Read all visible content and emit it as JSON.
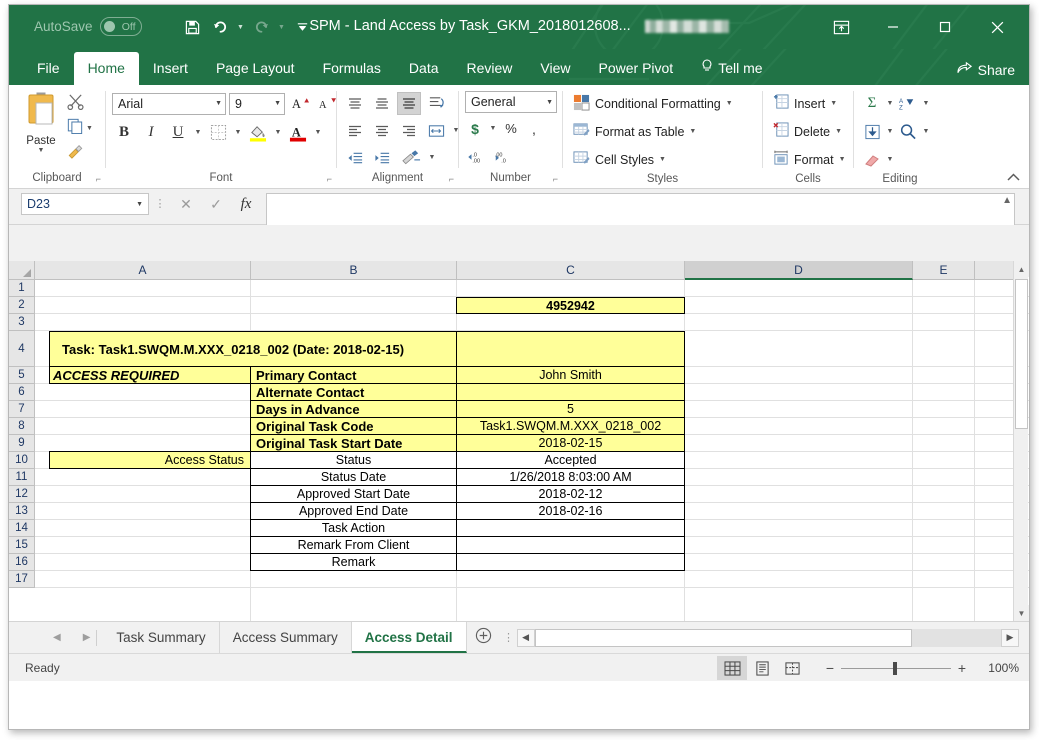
{
  "titlebar": {
    "autosave_label": "AutoSave",
    "autosave_state": "Off",
    "document_title": "SPM - Land Access by Task_GKM_2018012608...",
    "user_name_redacted": "",
    "quick_access": [
      {
        "name": "save",
        "label": "Save"
      },
      {
        "name": "undo",
        "label": "Undo"
      },
      {
        "name": "redo",
        "label": "Redo"
      },
      {
        "name": "customize-qat",
        "label": "Customize Quick Access Toolbar"
      }
    ],
    "window_controls": [
      {
        "name": "ribbon-display-options",
        "label": "Ribbon Display Options"
      },
      {
        "name": "minimize",
        "label": "Minimize"
      },
      {
        "name": "maximize",
        "label": "Maximize"
      },
      {
        "name": "close",
        "label": "Close"
      }
    ]
  },
  "ribbon_tabs": [
    {
      "label": "File",
      "active": false
    },
    {
      "label": "Home",
      "active": true
    },
    {
      "label": "Insert",
      "active": false
    },
    {
      "label": "Page Layout",
      "active": false
    },
    {
      "label": "Formulas",
      "active": false
    },
    {
      "label": "Data",
      "active": false
    },
    {
      "label": "Review",
      "active": false
    },
    {
      "label": "View",
      "active": false
    },
    {
      "label": "Power Pivot",
      "active": false
    }
  ],
  "tell_me": "Tell me",
  "share": "Share",
  "ribbon": {
    "clipboard": {
      "group_label": "Clipboard",
      "paste_label": "Paste",
      "cut_label": "Cut",
      "copy_label": "Copy",
      "format_painter_label": "Format Painter"
    },
    "font": {
      "group_label": "Font",
      "font_name": "Arial",
      "font_size": "9",
      "grow_font": "Increase Font Size",
      "shrink_font": "Decrease Font Size",
      "bold": "B",
      "italic": "I",
      "underline": "U",
      "borders": "Borders",
      "fill_color": "Fill Color",
      "font_color": "Font Color"
    },
    "alignment": {
      "group_label": "Alignment",
      "top_align": "Top Align",
      "middle_align": "Middle Align",
      "bottom_align": "Bottom Align",
      "orientation": "Orientation",
      "align_left": "Align Left",
      "center": "Center",
      "align_right": "Align Right",
      "wrap_text": "Wrap Text",
      "decrease_indent": "Decrease Indent",
      "increase_indent": "Increase Indent",
      "merge_center": "Merge & Center"
    },
    "number": {
      "group_label": "Number",
      "format": "General",
      "accounting": "Accounting Number Format",
      "percent": "Percent Style",
      "comma": "Comma Style",
      "increase_decimal": "Increase Decimal",
      "decrease_decimal": "Decrease Decimal"
    },
    "styles": {
      "group_label": "Styles",
      "conditional_formatting": "Conditional Formatting",
      "format_as_table": "Format as Table",
      "cell_styles": "Cell Styles"
    },
    "cells": {
      "group_label": "Cells",
      "insert": "Insert",
      "delete": "Delete",
      "format": "Format"
    },
    "editing": {
      "group_label": "Editing",
      "autosum": "AutoSum",
      "sort_filter": "Sort & Filter",
      "fill": "Fill",
      "find_select": "Find & Select",
      "clear": "Clear"
    }
  },
  "formula_bar": {
    "name_box": "D23",
    "cancel": "Cancel",
    "enter": "Enter",
    "insert_function": "fx",
    "formula_value": ""
  },
  "grid": {
    "columns": [
      "A",
      "B",
      "C",
      "D",
      "E"
    ],
    "selected_column": "D",
    "rows": [
      "1",
      "2",
      "3",
      "4",
      "5",
      "6",
      "7",
      "8",
      "9",
      "10",
      "11",
      "12",
      "13",
      "14",
      "15",
      "16",
      "17"
    ],
    "cells": {
      "C2": "4952942",
      "A4": "Task: Task1.SWQM.M.XXX_0218_002 (Date: 2018-02-15)",
      "A5": "ACCESS REQUIRED",
      "B5": "Primary Contact",
      "C5": "John Smith",
      "B6": "Alternate Contact",
      "C6": "",
      "B7": "Days in Advance",
      "C7": "5",
      "B8": "Original Task Code",
      "C8": "Task1.SWQM.M.XXX_0218_002",
      "B9": "Original Task Start Date",
      "C9": "2018-02-15",
      "A10": "Access Status",
      "B10": "Status",
      "C10": "Accepted",
      "B11": "Status Date",
      "C11": "1/26/2018 8:03:00 AM",
      "B12": "Approved Start Date",
      "C12": "2018-02-12",
      "B13": "Approved End Date",
      "C13": "2018-02-16",
      "B14": "Task Action",
      "C14": "",
      "B15": "Remark From Client",
      "C15": "",
      "B16": "Remark",
      "C16": ""
    }
  },
  "sheet_tabs": {
    "tabs": [
      {
        "label": "Task Summary",
        "active": false
      },
      {
        "label": "Access Summary",
        "active": false
      },
      {
        "label": "Access Detail",
        "active": true
      }
    ],
    "new_sheet": "+",
    "first_tab": "First Sheet",
    "prev_tab": "Previous Sheet"
  },
  "status_bar": {
    "status": "Ready",
    "views": [
      {
        "name": "normal-view",
        "label": "Normal"
      },
      {
        "name": "page-layout-view",
        "label": "Page Layout"
      },
      {
        "name": "page-break-preview",
        "label": "Page Break Preview"
      }
    ],
    "zoom_out": "−",
    "zoom_in": "+",
    "zoom_level": "100%"
  },
  "colors": {
    "excel_green": "#217346",
    "cell_yellow": "#ffff99",
    "error_green": "#0f7b3f",
    "header_gray": "#e6e6e6"
  }
}
